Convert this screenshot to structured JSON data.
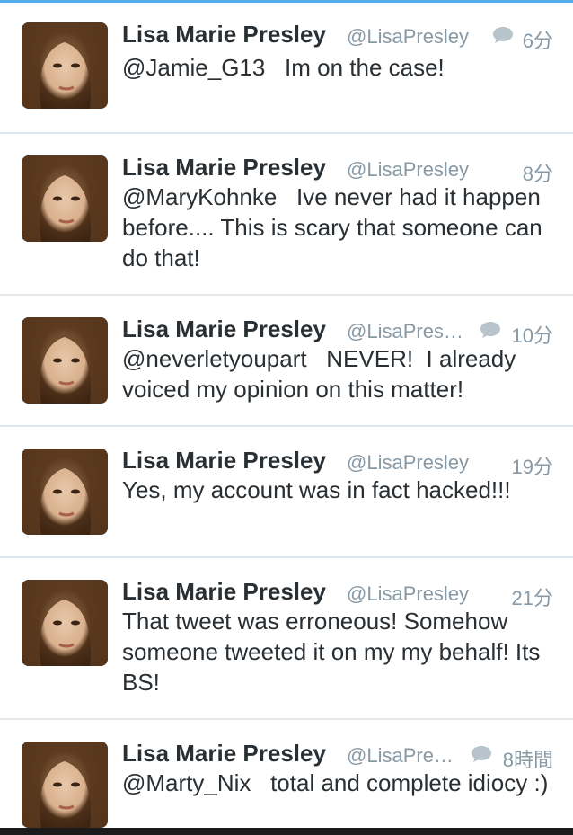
{
  "tweets": [
    {
      "name": "Lisa Marie Presley",
      "handle": "@LisaPresley",
      "time": "6分",
      "text": "@Jamie_G13   Im on the case!",
      "has_reply_icon": true
    },
    {
      "name": "Lisa Marie Presley",
      "handle": "@LisaPresley",
      "time": "8分",
      "text": "@MaryKohnke   Ive never had it happen before.... This is scary that someone can do that!",
      "has_reply_icon": false
    },
    {
      "name": "Lisa Marie Presley",
      "handle": "@LisaPres…",
      "time": "10分",
      "text": "@neverletyoupart   NEVER!  I already voiced my opinion on this matter!",
      "has_reply_icon": true
    },
    {
      "name": "Lisa Marie Presley",
      "handle": "@LisaPresley",
      "time": "19分",
      "text": "Yes, my account was in fact hacked!!!",
      "has_reply_icon": false
    },
    {
      "name": "Lisa Marie Presley",
      "handle": "@LisaPresley",
      "time": "21分",
      "text": "That tweet was erroneous! Somehow someone tweeted it on my my behalf! Its BS!",
      "has_reply_icon": false
    },
    {
      "name": "Lisa Marie Presley",
      "handle": "@LisaPre…",
      "time": "8時間",
      "text": "@Marty_Nix   total and complete idiocy :)",
      "has_reply_icon": true
    }
  ],
  "colors": {
    "accent": "#55acee",
    "secondary_text": "#8899a6",
    "primary_text": "#292f33",
    "divider": "#e1e8ed"
  }
}
